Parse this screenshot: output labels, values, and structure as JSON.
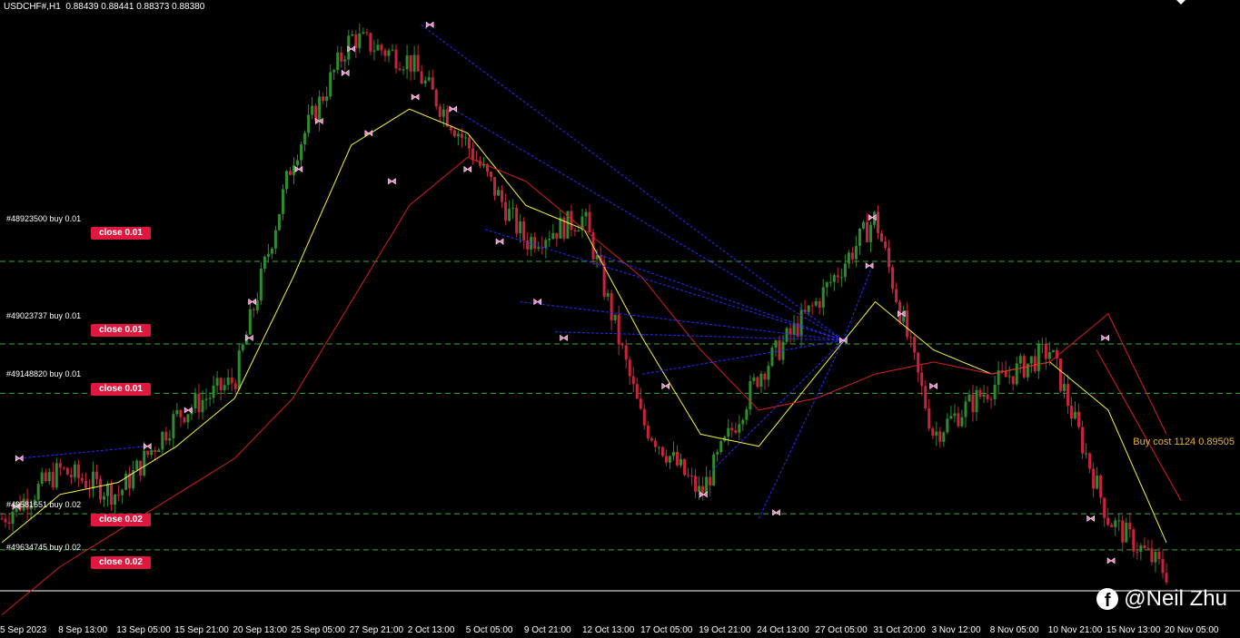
{
  "header": {
    "symbol": "USDCHF#,H1",
    "quote": "0.88439 0.88441 0.88373 0.88380"
  },
  "orders": [
    {
      "label": "#48923500 buy 0.01",
      "close": "close 0.01",
      "price": 0.89935
    },
    {
      "label": "#49023737 buy 0.01",
      "close": "close 0.01",
      "price": 0.8925
    },
    {
      "label": "#49148820 buy 0.01",
      "close": "close 0.01",
      "price": 0.8884
    },
    {
      "label": "#49581651 buy 0.02",
      "close": "close 0.02",
      "price": 0.8784
    },
    {
      "label": "#49634745 buy 0.02",
      "close": "close 0.02",
      "price": 0.8754
    }
  ],
  "buy_cost": {
    "text": "Buy cost 1124 0.89505",
    "price": 0.89505
  },
  "x_ticks": [
    "5 Sep 2023",
    "8 Sep 13:00",
    "13 Sep 05:00",
    "15 Sep 21:00",
    "20 Sep 13:00",
    "25 Sep 05:00",
    "27 Sep 21:00",
    "2 Oct 13:00",
    "5 Oct 05:00",
    "9 Oct 21:00",
    "12 Oct 13:00",
    "17 Oct 05:00",
    "19 Oct 21:00",
    "24 Oct 13:00",
    "27 Oct 05:00",
    "31 Oct 20:00",
    "3 Nov 12:00",
    "8 Nov 05:00",
    "10 Nov 21:00",
    "15 Nov 13:00",
    "20 Nov 05:00"
  ],
  "watermark": {
    "text": "@Neil Zhu",
    "icon": "facebook-icon"
  },
  "colors": {
    "background": "#000000",
    "bull_candle": "#2e8b2e",
    "bear_candle": "#c8233c",
    "fast_ma": "#f5f542",
    "slow_ma": "#d42020",
    "order_line": "#3aa83a",
    "trade_link": "#2a2aff",
    "marker": "#ff6fc8",
    "close_button": "#e0173f",
    "buy_cost": "#e8b233"
  },
  "chart_data": {
    "type": "line",
    "title": "USDCHF#,H1",
    "ylim": [
      0.872,
      0.92
    ],
    "x": [
      "5 Sep 2023",
      "8 Sep 13:00",
      "13 Sep 05:00",
      "15 Sep 21:00",
      "20 Sep 13:00",
      "25 Sep 05:00",
      "27 Sep 21:00",
      "2 Oct 13:00",
      "5 Oct 05:00",
      "9 Oct 21:00",
      "12 Oct 13:00",
      "17 Oct 05:00",
      "19 Oct 21:00",
      "24 Oct 13:00",
      "27 Oct 05:00",
      "31 Oct 20:00",
      "3 Nov 12:00",
      "8 Nov 05:00",
      "10 Nov 21:00",
      "15 Nov 13:00",
      "20 Nov 05:00"
    ],
    "series": [
      {
        "values": [
          0.878,
          0.882,
          0.88,
          0.8865,
          0.8895,
          0.908,
          0.918,
          0.916,
          0.909,
          0.901,
          0.903,
          0.886,
          0.88,
          0.89,
          0.896,
          0.903,
          0.885,
          0.889,
          0.892,
          0.878,
          0.8735
        ]
      },
      {
        "values": [
          0.876,
          0.88,
          0.881,
          0.884,
          0.888,
          0.898,
          0.909,
          0.912,
          0.91,
          0.904,
          0.902,
          0.893,
          0.885,
          0.884,
          0.89,
          0.896,
          0.892,
          0.89,
          0.891,
          0.887,
          0.876
        ]
      },
      {
        "values": [
          0.87,
          0.874,
          0.877,
          0.88,
          0.883,
          0.888,
          0.896,
          0.904,
          0.908,
          0.906,
          0.902,
          0.898,
          0.892,
          0.887,
          0.888,
          0.89,
          0.891,
          0.89,
          0.891,
          0.895,
          0.885
        ]
      }
    ]
  }
}
